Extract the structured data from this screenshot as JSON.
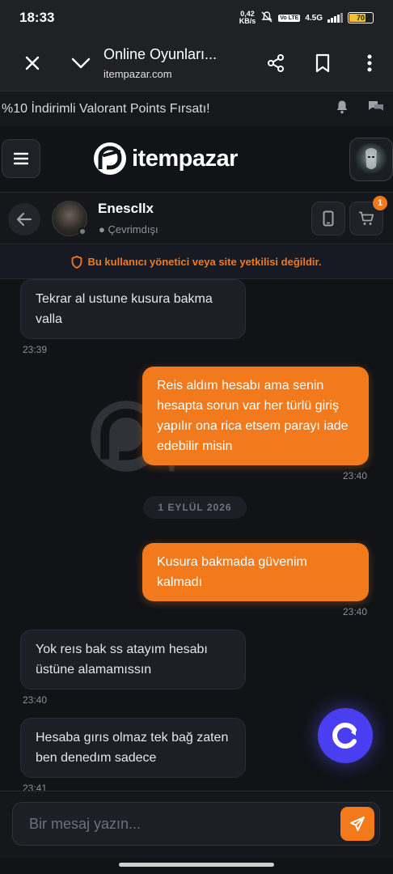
{
  "status_bar": {
    "time": "18:33",
    "net_speed": "0,42",
    "net_unit": "KB/s",
    "volte": "Vo LTE",
    "network": "4.5G",
    "battery": "70"
  },
  "browser": {
    "page_title": "Online Oyunları...",
    "url": "itempazar.com",
    "icons": [
      "close-icon",
      "chevron-down-icon",
      "share-icon",
      "bookmark-icon",
      "more-vert-icon"
    ]
  },
  "promo": {
    "text": "%10 İndirimli Valorant Points Fırsatı!"
  },
  "site": {
    "logo_text": "itempazar",
    "brand_color": "#f27a1d"
  },
  "chat_header": {
    "username": "Enescllx",
    "status": "● Çevrimdışı",
    "cart_count": "1"
  },
  "warning": {
    "text": "Bu kullanıcı yönetici veya site yetkilisi değildir."
  },
  "watermark": {
    "line1": "item",
    "line2": "pazar",
    "suffix": ".com"
  },
  "messages": [
    {
      "direction": "in",
      "text": "Tekrar al ustune kusura bakma valla",
      "time": "23:39"
    },
    {
      "direction": "out",
      "text": "Reis aldım hesabı ama senin hesapta sorun var her türlü giriş yapılır ona rica etsem parayı iade edebilir misin",
      "time": "23:40"
    },
    {
      "direction": "out",
      "text": "Kusura bakmada güvenim kalmadı",
      "time": "23:40"
    },
    {
      "direction": "in",
      "text": "Yok reıs bak ss atayım hesabı üstüne alamamıssın",
      "time": "23:40"
    },
    {
      "direction": "in",
      "text": "Hesaba gırıs olmaz tek bağ zaten ben denedım sadece",
      "time": "23:41"
    }
  ],
  "date_separator": "1 EYLÜL 2026",
  "composer": {
    "placeholder": "Bir mesaj yazın..."
  }
}
